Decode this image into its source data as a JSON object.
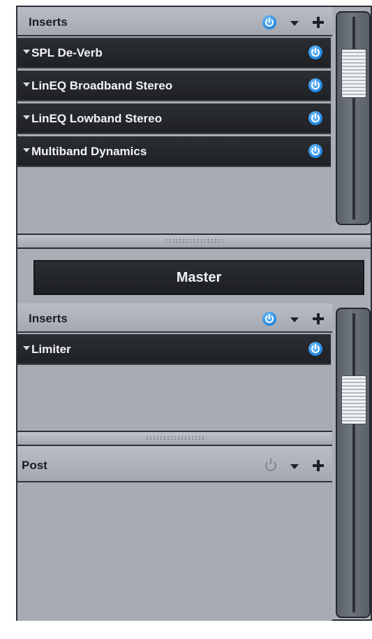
{
  "top_inserts": {
    "title": "Inserts",
    "plugins": [
      {
        "label": "SPL De-Verb"
      },
      {
        "label": "LinEQ Broadband Stereo"
      },
      {
        "label": "LinEQ Lowband Stereo"
      },
      {
        "label": "Multiband Dynamics"
      }
    ],
    "grip_text": ":::::::::::::::::"
  },
  "master": {
    "label": "Master"
  },
  "bottom_inserts": {
    "title": "Inserts",
    "plugins": [
      {
        "label": "Limiter"
      }
    ],
    "grip_text": ":::::::::::::::::"
  },
  "post": {
    "title": "Post"
  },
  "colors": {
    "accent": "#1f86e0",
    "row_bg": "#2b2e33",
    "panel_bg": "#a7acb4"
  },
  "icons": [
    "power-icon",
    "chevron-down-icon",
    "plus-icon",
    "fader-icon"
  ]
}
